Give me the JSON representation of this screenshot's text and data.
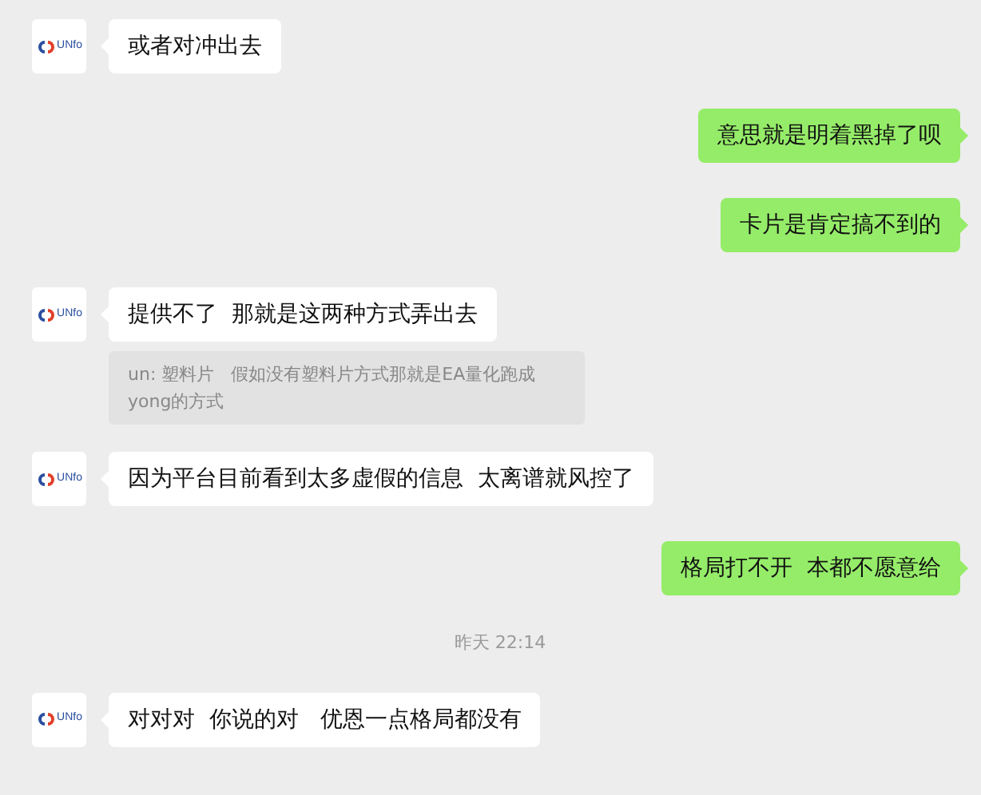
{
  "messages": [
    {
      "kind": "received",
      "avatar": "UNfo",
      "text": "或者对冲出去"
    },
    {
      "kind": "sent",
      "text": "意思就是明着黑掉了呗"
    },
    {
      "kind": "sent",
      "text": "卡片是肯定搞不到的"
    },
    {
      "kind": "received",
      "avatar": "UNfo",
      "text": "提供不了  那就是这两种方式弄出去"
    },
    {
      "kind": "quote",
      "text": "un: 塑料片   假如没有塑料片方式那就是EA量化跑成yong的方式"
    },
    {
      "kind": "received",
      "avatar": "UNfo",
      "text": "因为平台目前看到太多虚假的信息  太离谱就风控了"
    },
    {
      "kind": "sent",
      "text": "格局打不开  本都不愿意给"
    },
    {
      "kind": "time",
      "text": "昨天 22:14"
    },
    {
      "kind": "received",
      "avatar": "UNfo",
      "text": "对对对  你说的对   优恩一点格局都没有"
    }
  ]
}
